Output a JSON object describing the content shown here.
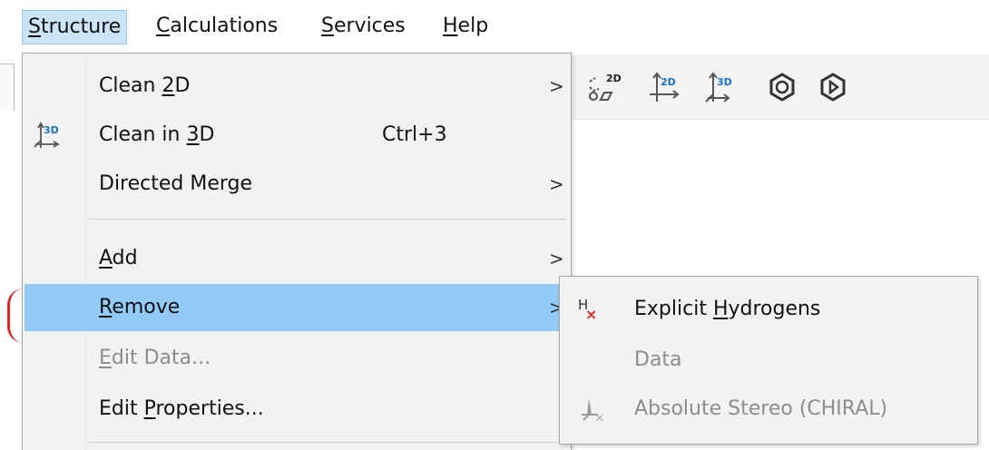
{
  "menubar": {
    "items": [
      {
        "label_mnemonic": "S",
        "label_rest": "tructure"
      },
      {
        "label_mnemonic": "C",
        "label_rest": "alculations"
      },
      {
        "label_mnemonic": "S",
        "label_rest": "ervices"
      },
      {
        "label_mnemonic": "H",
        "label_rest": "elp"
      }
    ]
  },
  "structure_menu": {
    "clean_2d": {
      "pre": "Clean ",
      "mnemonic": "2",
      "post": "D"
    },
    "clean_3d": {
      "pre": "Clean in ",
      "mnemonic": "3",
      "post": "D",
      "shortcut": "Ctrl+3",
      "icon": "clean-3d-icon"
    },
    "directed_merge": {
      "label": "Directed Merge"
    },
    "add": {
      "mnemonic": "A",
      "post": "dd"
    },
    "remove": {
      "mnemonic": "R",
      "post": "emove"
    },
    "edit_data": {
      "mnemonic": "E",
      "post": "dit Data..."
    },
    "edit_properties": {
      "pre": "Edit ",
      "mnemonic": "P",
      "post": "roperties..."
    },
    "submenu_arrow": ">"
  },
  "remove_submenu": {
    "explicit_hydrogens": {
      "pre": "Explicit ",
      "mnemonic": "H",
      "post": "ydrogens",
      "icon_letter": "H",
      "icon_mark": "×"
    },
    "data": {
      "label": "Data"
    },
    "absolute_stereo": {
      "label": "Absolute Stereo (CHIRAL)",
      "icon_mark": "×"
    }
  },
  "toolbar": {
    "icons": [
      "clean-2d-toolbar-icon",
      "clean-2d-axis-icon",
      "clean-3d-axis-icon",
      "aromatize-icon",
      "dearomatize-icon"
    ],
    "label_2d": "2D",
    "label_3d": "3D"
  },
  "colors": {
    "highlight": "#91c9f7",
    "menubar_active": "#cce4f7",
    "accent_blue": "#1a73c8",
    "remove_red": "#e0261d"
  }
}
